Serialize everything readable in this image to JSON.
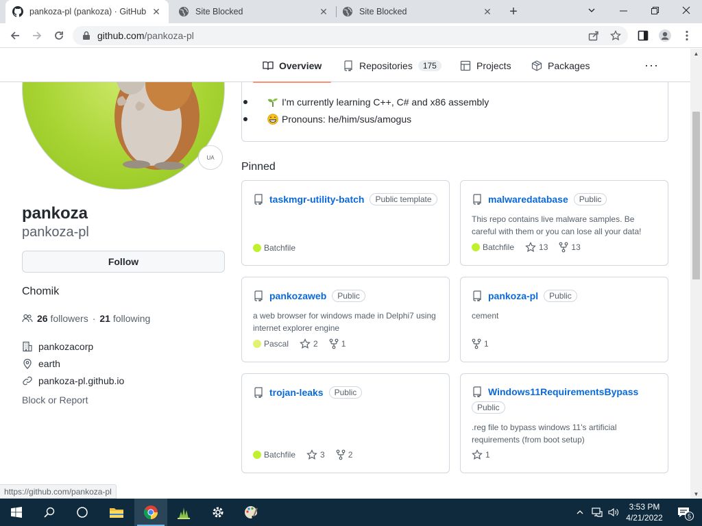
{
  "browser": {
    "tabs": [
      {
        "title": "pankoza-pl (pankoza) · GitHub",
        "active": true,
        "favicon": "github-icon"
      },
      {
        "title": "Site Blocked",
        "active": false,
        "favicon": "globe-icon"
      },
      {
        "title": "Site Blocked",
        "active": false,
        "favicon": "globe-icon"
      }
    ],
    "url_host": "github.com",
    "url_path": "/pankoza-pl"
  },
  "profile": {
    "name": "pankoza",
    "login": "pankoza-pl",
    "follow_label": "Follow",
    "bio": "Chomik",
    "followers_count": "26",
    "followers_label": "followers",
    "separator": "·",
    "following_count": "21",
    "following_label": "following",
    "company": "pankozacorp",
    "location": "earth",
    "website": "pankoza-pl.github.io",
    "block_label": "Block or Report",
    "avatar_badge": "UA"
  },
  "nav": {
    "items": [
      {
        "label": "Overview",
        "icon": "book-icon",
        "active": true
      },
      {
        "label": "Repositories",
        "icon": "repo-icon",
        "count": "175"
      },
      {
        "label": "Projects",
        "icon": "table-icon"
      },
      {
        "label": "Packages",
        "icon": "package-icon"
      }
    ],
    "more": "···"
  },
  "readme": {
    "items": [
      {
        "emoji": "seedling-emoji",
        "text": "I'm currently learning C++, C# and x86 assembly"
      },
      {
        "emoji": "grin-emoji",
        "text": "Pronouns: he/him/sus/amogus"
      }
    ]
  },
  "pinned": {
    "title": "Pinned",
    "repos": [
      {
        "name": "taskmgr-utility-batch",
        "badge": "Public template",
        "description": "",
        "language": "Batchfile",
        "language_color": "#c1f12e",
        "stars": "",
        "forks": ""
      },
      {
        "name": "malwaredatabase",
        "badge": "Public",
        "description": "This repo contains live malware samples. Be careful with them or you can lose all your data!",
        "language": "Batchfile",
        "language_color": "#c1f12e",
        "stars": "13",
        "forks": "13"
      },
      {
        "name": "pankozaweb",
        "badge": "Public",
        "description": "a web browser for windows made in Delphi7 using internet explorer engine",
        "language": "Pascal",
        "language_color": "#e3f171",
        "stars": "2",
        "forks": "1"
      },
      {
        "name": "pankoza-pl",
        "badge": "Public",
        "description": "cement",
        "language": "",
        "language_color": "",
        "stars": "",
        "forks": "1"
      },
      {
        "name": "trojan-leaks",
        "badge": "Public",
        "description": "",
        "language": "Batchfile",
        "language_color": "#c1f12e",
        "stars": "3",
        "forks": "2"
      },
      {
        "name": "Windows11RequirementsBypass",
        "badge": "Public",
        "description": ".reg file to bypass windows 11's artificial requirements (from boot setup)",
        "language": "",
        "language_color": "",
        "stars": "1",
        "forks": ""
      }
    ]
  },
  "status_bar": {
    "url": "https://github.com/pankoza-pl"
  },
  "taskbar": {
    "time": "3:53 PM",
    "date": "4/21/2022",
    "notification_count": "5"
  }
}
